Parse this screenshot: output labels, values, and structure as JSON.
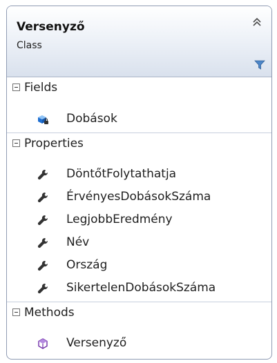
{
  "class_shape": {
    "title": "Versenyző",
    "subtitle": "Class",
    "sections": [
      {
        "label": "Fields",
        "items": [
          {
            "label": "Dobások",
            "icon": "field-icon"
          }
        ]
      },
      {
        "label": "Properties",
        "items": [
          {
            "label": "DöntőtFolytathatja",
            "icon": "wrench-icon"
          },
          {
            "label": "ÉrvényesDobásokSzáma",
            "icon": "wrench-icon"
          },
          {
            "label": "LegjobbEredmény",
            "icon": "wrench-icon"
          },
          {
            "label": "Név",
            "icon": "wrench-icon"
          },
          {
            "label": "Ország",
            "icon": "wrench-icon"
          },
          {
            "label": "SikertelenDobásokSzáma",
            "icon": "wrench-icon"
          }
        ]
      },
      {
        "label": "Methods",
        "items": [
          {
            "label": "Versenyző",
            "icon": "method-icon"
          }
        ]
      }
    ],
    "colors": {
      "border": "#8f9bb3",
      "header_gradient_end": "#d9e1ed",
      "field_icon": "#1f6fd1",
      "method_icon": "#6f2da8"
    }
  }
}
